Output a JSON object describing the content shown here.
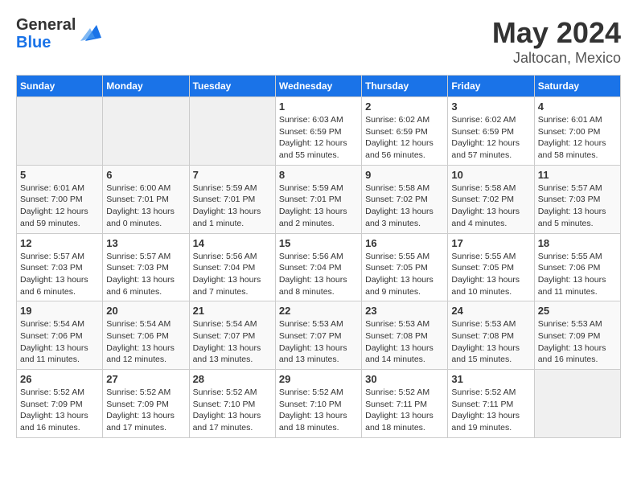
{
  "logo": {
    "general": "General",
    "blue": "Blue"
  },
  "header": {
    "month": "May 2024",
    "location": "Jaltocan, Mexico"
  },
  "weekdays": [
    "Sunday",
    "Monday",
    "Tuesday",
    "Wednesday",
    "Thursday",
    "Friday",
    "Saturday"
  ],
  "weeks": [
    [
      {
        "day": "",
        "info": ""
      },
      {
        "day": "",
        "info": ""
      },
      {
        "day": "",
        "info": ""
      },
      {
        "day": "1",
        "info": "Sunrise: 6:03 AM\nSunset: 6:59 PM\nDaylight: 12 hours\nand 55 minutes."
      },
      {
        "day": "2",
        "info": "Sunrise: 6:02 AM\nSunset: 6:59 PM\nDaylight: 12 hours\nand 56 minutes."
      },
      {
        "day": "3",
        "info": "Sunrise: 6:02 AM\nSunset: 6:59 PM\nDaylight: 12 hours\nand 57 minutes."
      },
      {
        "day": "4",
        "info": "Sunrise: 6:01 AM\nSunset: 7:00 PM\nDaylight: 12 hours\nand 58 minutes."
      }
    ],
    [
      {
        "day": "5",
        "info": "Sunrise: 6:01 AM\nSunset: 7:00 PM\nDaylight: 12 hours\nand 59 minutes."
      },
      {
        "day": "6",
        "info": "Sunrise: 6:00 AM\nSunset: 7:01 PM\nDaylight: 13 hours\nand 0 minutes."
      },
      {
        "day": "7",
        "info": "Sunrise: 5:59 AM\nSunset: 7:01 PM\nDaylight: 13 hours\nand 1 minute."
      },
      {
        "day": "8",
        "info": "Sunrise: 5:59 AM\nSunset: 7:01 PM\nDaylight: 13 hours\nand 2 minutes."
      },
      {
        "day": "9",
        "info": "Sunrise: 5:58 AM\nSunset: 7:02 PM\nDaylight: 13 hours\nand 3 minutes."
      },
      {
        "day": "10",
        "info": "Sunrise: 5:58 AM\nSunset: 7:02 PM\nDaylight: 13 hours\nand 4 minutes."
      },
      {
        "day": "11",
        "info": "Sunrise: 5:57 AM\nSunset: 7:03 PM\nDaylight: 13 hours\nand 5 minutes."
      }
    ],
    [
      {
        "day": "12",
        "info": "Sunrise: 5:57 AM\nSunset: 7:03 PM\nDaylight: 13 hours\nand 6 minutes."
      },
      {
        "day": "13",
        "info": "Sunrise: 5:57 AM\nSunset: 7:03 PM\nDaylight: 13 hours\nand 6 minutes."
      },
      {
        "day": "14",
        "info": "Sunrise: 5:56 AM\nSunset: 7:04 PM\nDaylight: 13 hours\nand 7 minutes."
      },
      {
        "day": "15",
        "info": "Sunrise: 5:56 AM\nSunset: 7:04 PM\nDaylight: 13 hours\nand 8 minutes."
      },
      {
        "day": "16",
        "info": "Sunrise: 5:55 AM\nSunset: 7:05 PM\nDaylight: 13 hours\nand 9 minutes."
      },
      {
        "day": "17",
        "info": "Sunrise: 5:55 AM\nSunset: 7:05 PM\nDaylight: 13 hours\nand 10 minutes."
      },
      {
        "day": "18",
        "info": "Sunrise: 5:55 AM\nSunset: 7:06 PM\nDaylight: 13 hours\nand 11 minutes."
      }
    ],
    [
      {
        "day": "19",
        "info": "Sunrise: 5:54 AM\nSunset: 7:06 PM\nDaylight: 13 hours\nand 11 minutes."
      },
      {
        "day": "20",
        "info": "Sunrise: 5:54 AM\nSunset: 7:06 PM\nDaylight: 13 hours\nand 12 minutes."
      },
      {
        "day": "21",
        "info": "Sunrise: 5:54 AM\nSunset: 7:07 PM\nDaylight: 13 hours\nand 13 minutes."
      },
      {
        "day": "22",
        "info": "Sunrise: 5:53 AM\nSunset: 7:07 PM\nDaylight: 13 hours\nand 13 minutes."
      },
      {
        "day": "23",
        "info": "Sunrise: 5:53 AM\nSunset: 7:08 PM\nDaylight: 13 hours\nand 14 minutes."
      },
      {
        "day": "24",
        "info": "Sunrise: 5:53 AM\nSunset: 7:08 PM\nDaylight: 13 hours\nand 15 minutes."
      },
      {
        "day": "25",
        "info": "Sunrise: 5:53 AM\nSunset: 7:09 PM\nDaylight: 13 hours\nand 16 minutes."
      }
    ],
    [
      {
        "day": "26",
        "info": "Sunrise: 5:52 AM\nSunset: 7:09 PM\nDaylight: 13 hours\nand 16 minutes."
      },
      {
        "day": "27",
        "info": "Sunrise: 5:52 AM\nSunset: 7:09 PM\nDaylight: 13 hours\nand 17 minutes."
      },
      {
        "day": "28",
        "info": "Sunrise: 5:52 AM\nSunset: 7:10 PM\nDaylight: 13 hours\nand 17 minutes."
      },
      {
        "day": "29",
        "info": "Sunrise: 5:52 AM\nSunset: 7:10 PM\nDaylight: 13 hours\nand 18 minutes."
      },
      {
        "day": "30",
        "info": "Sunrise: 5:52 AM\nSunset: 7:11 PM\nDaylight: 13 hours\nand 18 minutes."
      },
      {
        "day": "31",
        "info": "Sunrise: 5:52 AM\nSunset: 7:11 PM\nDaylight: 13 hours\nand 19 minutes."
      },
      {
        "day": "",
        "info": ""
      }
    ]
  ]
}
